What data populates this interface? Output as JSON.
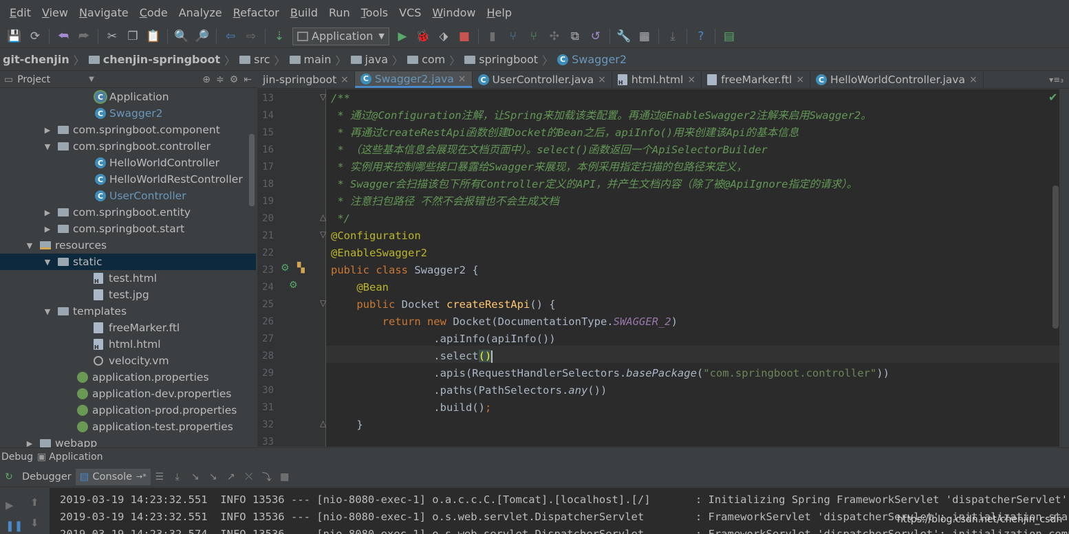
{
  "menu": [
    {
      "label": "Edit",
      "u": "E",
      "rest": "dit"
    },
    {
      "label": "View",
      "u": "V",
      "rest": "iew"
    },
    {
      "label": "Navigate",
      "u": "N",
      "rest": "avigate"
    },
    {
      "label": "Code",
      "u": "C",
      "rest": "ode"
    },
    {
      "label": "Analyze",
      "u": "",
      "rest": "Analyze"
    },
    {
      "label": "Refactor",
      "u": "R",
      "rest": "efactor"
    },
    {
      "label": "Build",
      "u": "B",
      "rest": "uild"
    },
    {
      "label": "Run",
      "u": "",
      "rest": "Run"
    },
    {
      "label": "Tools",
      "u": "T",
      "rest": "ools"
    },
    {
      "label": "VCS",
      "u": "",
      "rest": "VCS"
    },
    {
      "label": "Window",
      "u": "W",
      "rest": "indow"
    },
    {
      "label": "Help",
      "u": "H",
      "rest": "elp"
    }
  ],
  "toolbar": {
    "run_config": "Application"
  },
  "breadcrumb": [
    "git-chenjin",
    "chenjin-springboot",
    "src",
    "main",
    "java",
    "com",
    "springboot",
    "Swagger2"
  ],
  "project_panel": {
    "title": "Project"
  },
  "tree": [
    {
      "label": "Application",
      "indent": 138,
      "icon": "app",
      "arrow": ""
    },
    {
      "label": "Swagger2",
      "indent": 138,
      "icon": "class",
      "arrow": "",
      "highlight": true
    },
    {
      "label": "com.springboot.component",
      "indent": 88,
      "icon": "folder",
      "arrow": "▶"
    },
    {
      "label": "com.springboot.controller",
      "indent": 88,
      "icon": "folder",
      "arrow": "▼"
    },
    {
      "label": "HelloWorldController",
      "indent": 138,
      "icon": "class",
      "arrow": ""
    },
    {
      "label": "HelloWorldRestController",
      "indent": 138,
      "icon": "class",
      "arrow": ""
    },
    {
      "label": "UserController",
      "indent": 138,
      "icon": "class",
      "arrow": "",
      "highlight": true
    },
    {
      "label": "com.springboot.entity",
      "indent": 88,
      "icon": "folder",
      "arrow": "▶"
    },
    {
      "label": "com.springboot.start",
      "indent": 88,
      "icon": "folder",
      "arrow": "▶"
    },
    {
      "label": "resources",
      "indent": 62,
      "icon": "res",
      "arrow": "▼"
    },
    {
      "label": "static",
      "indent": 88,
      "icon": "folder",
      "arrow": "▼",
      "selected": true
    },
    {
      "label": "test.html",
      "indent": 136,
      "icon": "html",
      "arrow": ""
    },
    {
      "label": "test.jpg",
      "indent": 136,
      "icon": "file",
      "arrow": ""
    },
    {
      "label": "templates",
      "indent": 88,
      "icon": "folder",
      "arrow": "▼"
    },
    {
      "label": "freeMarker.ftl",
      "indent": 136,
      "icon": "file",
      "arrow": ""
    },
    {
      "label": "html.html",
      "indent": 136,
      "icon": "html",
      "arrow": ""
    },
    {
      "label": "velocity.vm",
      "indent": 136,
      "icon": "vm",
      "arrow": ""
    },
    {
      "label": "application.properties",
      "indent": 112,
      "icon": "spring",
      "arrow": ""
    },
    {
      "label": "application-dev.properties",
      "indent": 112,
      "icon": "spring",
      "arrow": ""
    },
    {
      "label": "application-prod.properties",
      "indent": 112,
      "icon": "spring",
      "arrow": ""
    },
    {
      "label": "application-test.properties",
      "indent": 112,
      "icon": "spring",
      "arrow": ""
    },
    {
      "label": "webapp",
      "indent": 62,
      "icon": "folder",
      "arrow": "▶"
    }
  ],
  "tabs": [
    {
      "label": "jin-springboot",
      "icon": "",
      "active": false
    },
    {
      "label": "Swagger2.java",
      "icon": "class",
      "active": true
    },
    {
      "label": "UserController.java",
      "icon": "class",
      "active": false
    },
    {
      "label": "html.html",
      "icon": "html",
      "active": false
    },
    {
      "label": "freeMarker.ftl",
      "icon": "file",
      "active": false
    },
    {
      "label": "HelloWorldController.java",
      "icon": "class",
      "active": false
    }
  ],
  "code": {
    "line_numbers": [
      "13",
      "14",
      "15",
      "16",
      "17",
      "18",
      "19",
      "20",
      "21",
      "22",
      "23",
      "24",
      "25",
      "26",
      "27",
      "28",
      "29",
      "30",
      "31",
      "32",
      "33"
    ],
    "lines": [
      [
        {
          "t": "/**",
          "c": "cm"
        }
      ],
      [
        {
          "t": " * 通过@Configuration注解，让Spring来加载该类配置。再通过@EnableSwagger2注解来启用Swagger2。",
          "c": "cm"
        }
      ],
      [
        {
          "t": " * 再通过createRestApi函数创建Docket的Bean之后，apiInfo()用来创建该Api的基本信息",
          "c": "cm"
        }
      ],
      [
        {
          "t": " * （这些基本信息会展现在文档页面中）。select()函数返回一个ApiSelectorBuilder",
          "c": "cm"
        }
      ],
      [
        {
          "t": " * 实例用来控制哪些接口暴露给Swagger来展现，本例采用指定扫描的包路径来定义，",
          "c": "cm"
        }
      ],
      [
        {
          "t": " * Swagger会扫描该包下所有Controller定义的API，并产生文档内容（除了被@ApiIgnore指定的请求）。",
          "c": "cm"
        }
      ],
      [
        {
          "t": " * 注意扫包路径 不然不会报错也不会生成文档",
          "c": "cm"
        }
      ],
      [
        {
          "t": " */",
          "c": "cm"
        }
      ],
      [
        {
          "t": "@Configuration",
          "c": "an"
        }
      ],
      [
        {
          "t": "@EnableSwagger2",
          "c": "an"
        }
      ],
      [
        {
          "t": "public class ",
          "c": "kw"
        },
        {
          "t": "Swagger2 {",
          "c": ""
        }
      ],
      [
        {
          "t": "    ",
          "c": ""
        },
        {
          "t": "@Bean",
          "c": "an"
        }
      ],
      [
        {
          "t": "    ",
          "c": ""
        },
        {
          "t": "public ",
          "c": "kw"
        },
        {
          "t": "Docket ",
          "c": ""
        },
        {
          "t": "createRestApi",
          "c": "fn"
        },
        {
          "t": "() {",
          "c": ""
        }
      ],
      [
        {
          "t": "        ",
          "c": ""
        },
        {
          "t": "return new ",
          "c": "kw"
        },
        {
          "t": "Docket(DocumentationType.",
          "c": ""
        },
        {
          "t": "SWAGGER_2",
          "c": "cnst"
        },
        {
          "t": ")",
          "c": ""
        }
      ],
      [
        {
          "t": "                .apiInfo(apiInfo())",
          "c": ""
        }
      ],
      [
        {
          "t": "                .select",
          "c": ""
        },
        {
          "t": "()",
          "c": "paren-hl"
        },
        {
          "t": "",
          "c": "caret"
        }
      ],
      [
        {
          "t": "                .apis(RequestHandlerSelectors.",
          "c": ""
        },
        {
          "t": "basePackage",
          "c": "it"
        },
        {
          "t": "(",
          "c": ""
        },
        {
          "t": "\"com.springboot.controller\"",
          "c": "st"
        },
        {
          "t": "))",
          "c": ""
        }
      ],
      [
        {
          "t": "                .paths(PathSelectors.",
          "c": ""
        },
        {
          "t": "any",
          "c": "it"
        },
        {
          "t": "())",
          "c": ""
        }
      ],
      [
        {
          "t": "                .build()",
          "c": ""
        },
        {
          "t": ";",
          "c": "kw"
        }
      ],
      [
        {
          "t": "    }",
          "c": ""
        }
      ],
      [
        {
          "t": "",
          "c": ""
        }
      ]
    ]
  },
  "debug": {
    "label": "Debug",
    "config": "Application",
    "tab_debugger": "Debugger",
    "tab_console": "Console"
  },
  "console_lines": [
    "2019-03-19 14:23:32.551  INFO 13536 --- [nio-8080-exec-1] o.a.c.c.C.[Tomcat].[localhost].[/]       : Initializing Spring FrameworkServlet 'dispatcherServlet'",
    "2019-03-19 14:23:32.551  INFO 13536 --- [nio-8080-exec-1] o.s.web.servlet.DispatcherServlet        : FrameworkServlet 'dispatcherServlet': initialization started",
    "2019-03-19 14:23:32.574  INFO 13536 --- [nio-8080-exec-1] o.s.web.servlet.DispatcherServlet        : FrameworkServlet 'dispatcherServlet': initialization completed"
  ],
  "watermark": "https://blog.csdn.net/chenjin_csdn"
}
